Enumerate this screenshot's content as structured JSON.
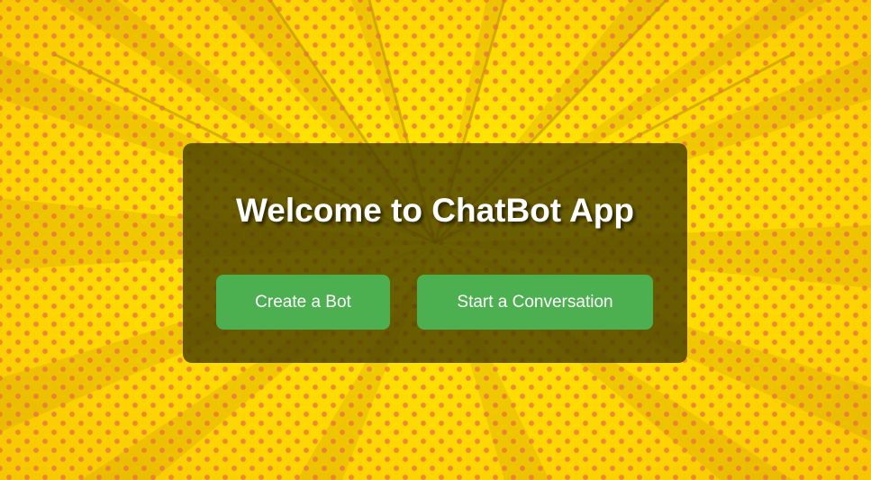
{
  "app": {
    "title": "Welcome to ChatBot App"
  },
  "actions": {
    "create_bot_label": "Create a Bot",
    "start_conversation_label": "Start a Conversation"
  },
  "colors": {
    "background_yellow": "#ffe100",
    "dot_color": "#eb6e46",
    "card_overlay": "#484000",
    "button_green": "#4caf50",
    "text_white": "#ffffff"
  }
}
